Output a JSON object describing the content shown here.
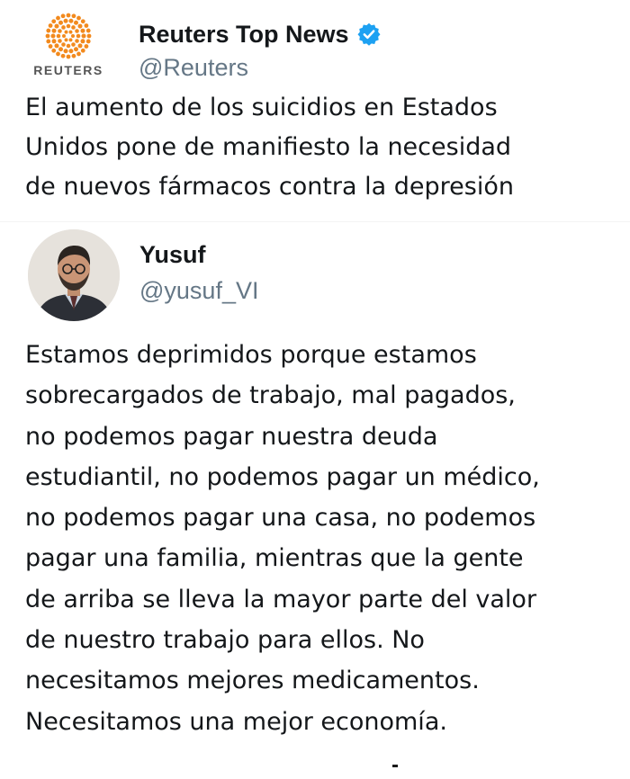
{
  "quoted_tweet": {
    "logo_icon": "reuters-logo-icon",
    "logo_wordmark": "REUTERS",
    "display_name": "Reuters Top News",
    "verified_icon": "verified-badge-icon",
    "handle": "@Reuters",
    "text": "El aumento de los suicidios en Estados\nUnidos pone de manifiesto la necesidad\nde nuevos fármacos contra la depresión"
  },
  "reply_tweet": {
    "avatar_icon": "avatar-photo",
    "display_name": "Yusuf",
    "handle": "@yusuf_VI",
    "text": "Estamos deprimidos porque estamos\nsobrecargados de trabajo, mal pagados,\nno podemos pagar nuestra deuda\nestudiantil, no podemos pagar un médico,\nno podemos pagar una casa, no podemos\npagar una familia, mientras que la gente\nde arriba se lleva la mayor parte del valor\nde nuestro trabajo para ellos. No\nnecesitamos mejores medicamentos.\nNecesitamos una mejor economía."
  },
  "colors": {
    "text_primary": "#14171a",
    "text_secondary": "#657786",
    "verified_blue": "#1da1f2",
    "reuters_orange": "#f28a1e"
  }
}
